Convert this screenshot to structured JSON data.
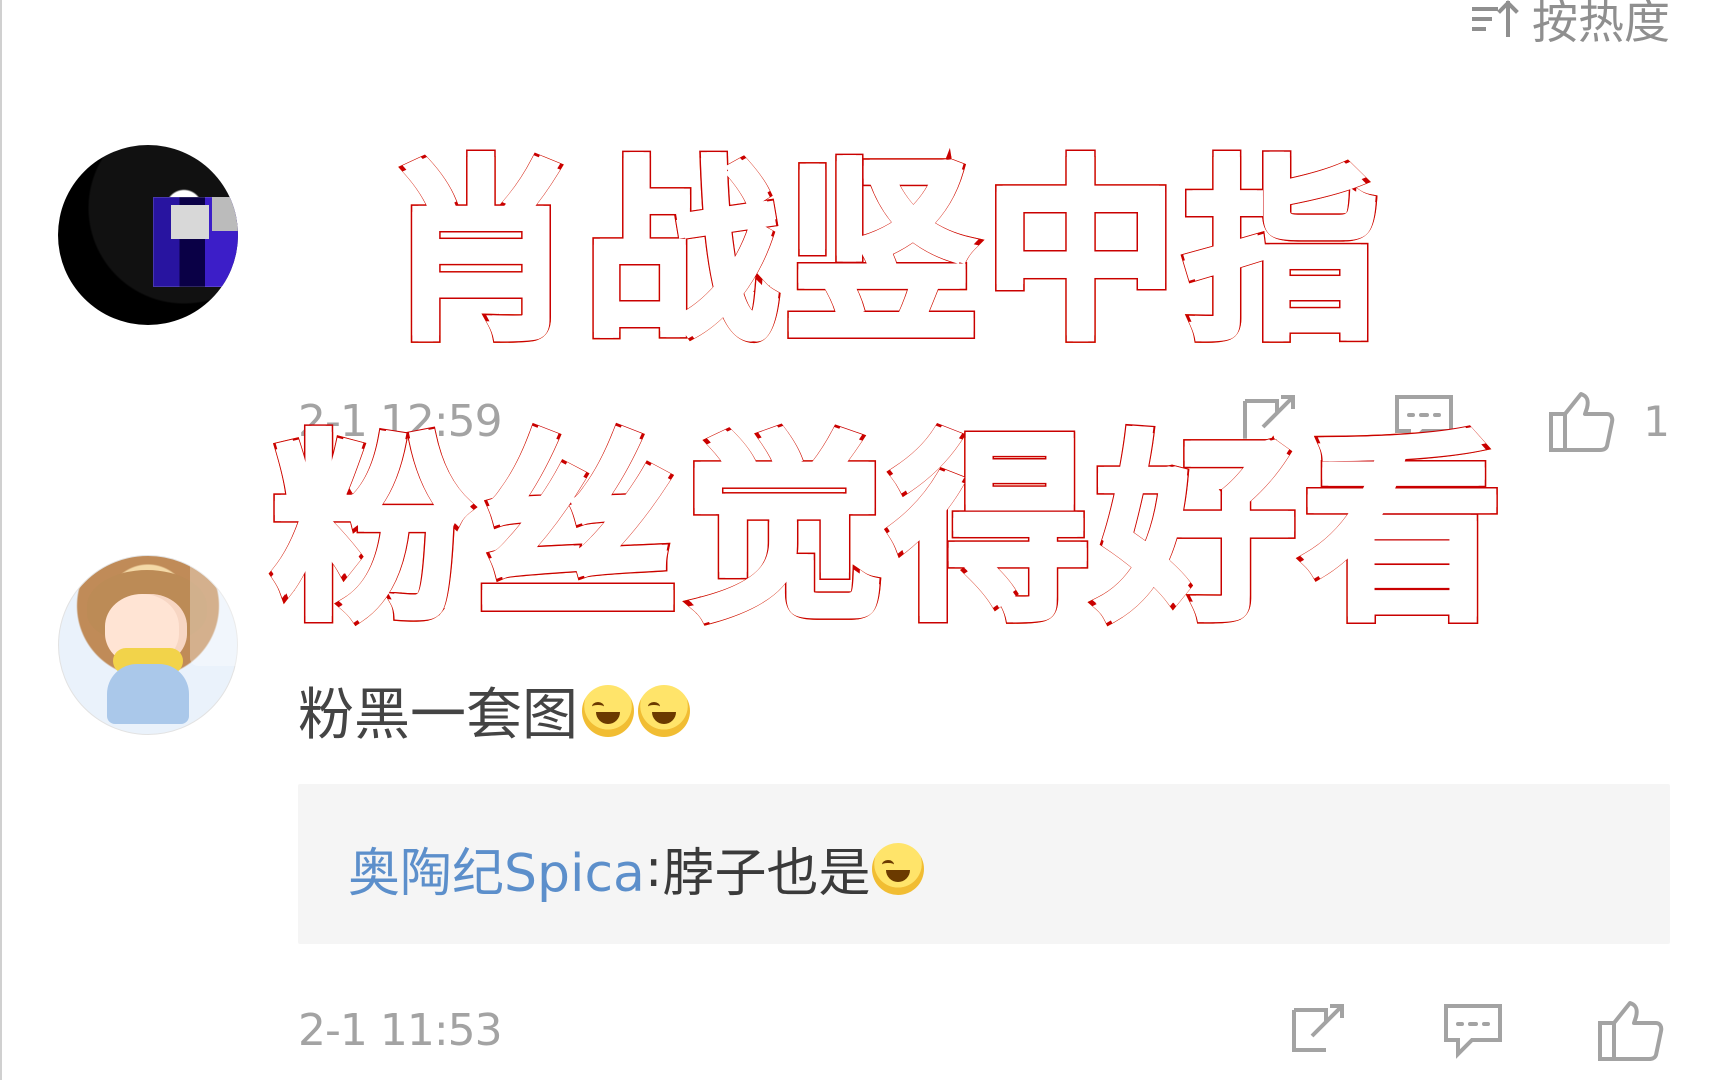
{
  "header": {
    "sort_label": "按热度"
  },
  "comments": [
    {
      "timestamp": "2-1 12:59",
      "like_count": "1"
    },
    {
      "timestamp": "2-1 11:53",
      "text": "粉黑一套图",
      "reply": {
        "user": "奥陶纪Spica",
        "separator": ": ",
        "text": "脖子也是"
      }
    }
  ],
  "overlay": {
    "line_1": "肖战竖中指",
    "line_2": "粉丝觉得好看"
  },
  "icons": {
    "sort": "sort-icon",
    "share": "share-icon",
    "comment": "comment-icon",
    "like": "thumbs-up-icon",
    "emoji": "laughing-emoji-icon"
  }
}
